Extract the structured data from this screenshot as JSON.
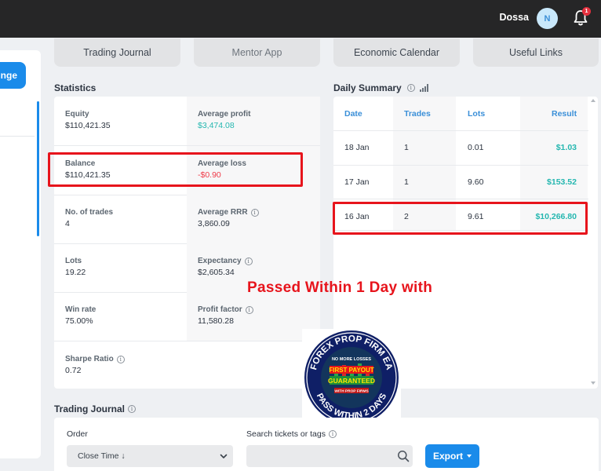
{
  "header": {
    "user_name": "Dossa",
    "avatar_initial": "N",
    "notification_count": "1"
  },
  "left_panel": {
    "button_label": "nge"
  },
  "tabs": [
    {
      "label": "Trading Journal"
    },
    {
      "label": "Mentor App"
    },
    {
      "label": "Economic Calendar"
    },
    {
      "label": "Useful Links"
    }
  ],
  "statistics": {
    "title": "Statistics",
    "equity": {
      "label": "Equity",
      "value": "$110,421.35"
    },
    "average_profit": {
      "label": "Average profit",
      "value": "$3,474.08"
    },
    "balance": {
      "label": "Balance",
      "value": "$110,421.35"
    },
    "average_loss": {
      "label": "Average loss",
      "value": "-$0.90"
    },
    "trades": {
      "label": "No. of trades",
      "value": "4"
    },
    "average_rrr": {
      "label": "Average RRR",
      "value": "3,860.09"
    },
    "lots": {
      "label": "Lots",
      "value": "19.22"
    },
    "expectancy": {
      "label": "Expectancy",
      "value": "$2,605.34"
    },
    "win_rate": {
      "label": "Win rate",
      "value": "75.00%"
    },
    "profit_factor": {
      "label": "Profit factor",
      "value": "11,580.28"
    },
    "sharpe_ratio": {
      "label": "Sharpe Ratio",
      "value": "0.72"
    }
  },
  "daily_summary": {
    "title": "Daily Summary",
    "columns": [
      "Date",
      "Trades",
      "Lots",
      "Result"
    ],
    "rows": [
      {
        "date": "18 Jan",
        "trades": "1",
        "lots": "0.01",
        "result": "$1.03"
      },
      {
        "date": "17 Jan",
        "trades": "1",
        "lots": "9.60",
        "result": "$153.52"
      },
      {
        "date": "16 Jan",
        "trades": "2",
        "lots": "9.61",
        "result": "$10,266.80"
      }
    ]
  },
  "overlay": {
    "headline": "Passed Within 1 Day with",
    "logo_top_text": "FOREX PROP FIRM EA",
    "logo_bottom_text": "PASS WITHIN 2 DAYS",
    "logo_line1": "NO MORE LOSSES",
    "logo_line2": "FIRST PAYOUT",
    "logo_line3": "GUARANTEED",
    "logo_line4": "WITH PROP FIRMS"
  },
  "trading_journal": {
    "title": "Trading Journal",
    "order_label": "Order",
    "order_value": "Close Time ↓",
    "search_label": "Search tickets or tags",
    "search_placeholder": "",
    "export_label": "Export"
  },
  "colors": {
    "accent": "#1a8bea",
    "positive": "#25b7b0",
    "negative": "#ef3a48",
    "highlight": "#e7141c",
    "topbar": "#262627"
  }
}
